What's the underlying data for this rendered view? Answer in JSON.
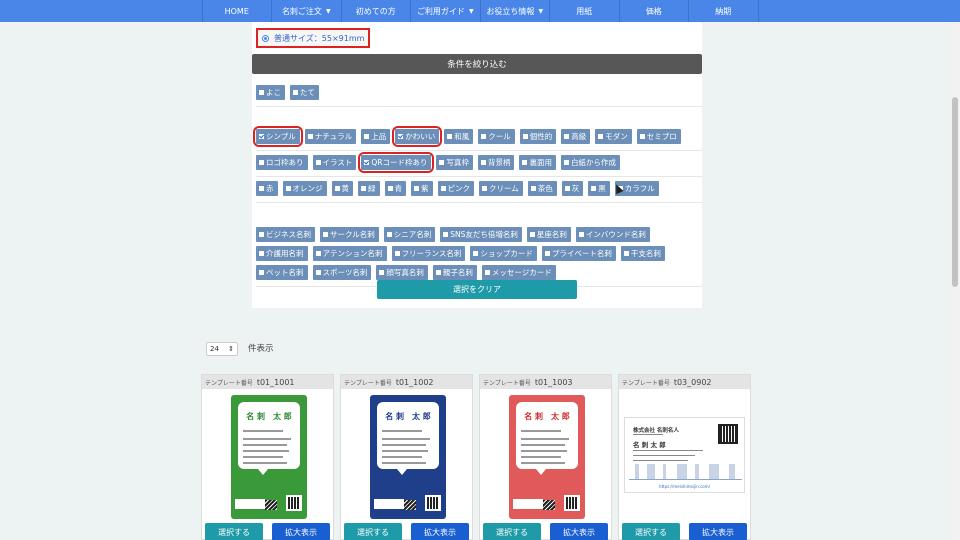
{
  "nav": [
    "HOME",
    "名刺ご注文",
    "初めての方",
    "ご利用ガイド",
    "お役立ち情報",
    "用紙",
    "価格",
    "納期"
  ],
  "nav_dropdown": [
    false,
    true,
    false,
    true,
    true,
    false,
    false,
    false
  ],
  "size_option": "普通サイズ：55×91mm",
  "refine_title": "条件を絞り込む",
  "filter_groups": [
    {
      "chips": [
        {
          "label": "よこ"
        },
        {
          "label": "たて"
        }
      ]
    },
    {
      "chips": [
        {
          "label": "シンプル",
          "checked": true,
          "hl": true
        },
        {
          "label": "ナチュラル"
        },
        {
          "label": "上品"
        },
        {
          "label": "かわいい",
          "checked": true,
          "hl": true
        },
        {
          "label": "和風"
        },
        {
          "label": "クール"
        },
        {
          "label": "個性的"
        },
        {
          "label": "高級"
        },
        {
          "label": "モダン"
        },
        {
          "label": "セミプロ"
        }
      ]
    },
    {
      "chips": [
        {
          "label": "ロゴ枠あり"
        },
        {
          "label": "イラスト"
        },
        {
          "label": "QRコード枠あり",
          "checked": true,
          "hl": true
        },
        {
          "label": "写真枠"
        },
        {
          "label": "背景柄"
        },
        {
          "label": "裏面用"
        },
        {
          "label": "白紙から作成"
        }
      ]
    },
    {
      "chips": [
        {
          "label": "赤"
        },
        {
          "label": "オレンジ"
        },
        {
          "label": "黄"
        },
        {
          "label": "緑"
        },
        {
          "label": "青"
        },
        {
          "label": "紫"
        },
        {
          "label": "ピンク"
        },
        {
          "label": "クリーム"
        },
        {
          "label": "茶色"
        },
        {
          "label": "灰"
        },
        {
          "label": "黒"
        },
        {
          "label": "カラフル"
        }
      ]
    },
    {
      "chips": [
        {
          "label": "ビジネス名刺"
        },
        {
          "label": "サークル名刺"
        },
        {
          "label": "シニア名刺"
        },
        {
          "label": "SNS友だち倍増名刺"
        },
        {
          "label": "星座名刺"
        },
        {
          "label": "インバウンド名刺"
        },
        {
          "label": "介護用名刺"
        },
        {
          "label": "アテンション名刺"
        },
        {
          "label": "フリーランス名刺"
        },
        {
          "label": "ショップカード"
        },
        {
          "label": "プライベート名刺"
        },
        {
          "label": "干支名刺"
        },
        {
          "label": "ペット名刺"
        },
        {
          "label": "スポーツ名刺"
        },
        {
          "label": "顔写真名刺"
        },
        {
          "label": "親子名刺"
        },
        {
          "label": "メッセージカード"
        }
      ]
    }
  ],
  "clear_button": "選択をクリア",
  "per_page": {
    "value": "24",
    "label": "件表示"
  },
  "template_label": "テンプレート番号",
  "select_label": "選択する",
  "zoom_label": "拡大表示",
  "templates": [
    {
      "id": "t01_1001",
      "color": "#3a9a3a",
      "orientation": "vertical",
      "title": "名 刺　太 郎",
      "title_color": "#2f8a2f"
    },
    {
      "id": "t01_1002",
      "color": "#1f3f8a",
      "orientation": "vertical",
      "title": "名 刺　太 郎",
      "title_color": "#1f3f8a"
    },
    {
      "id": "t01_1003",
      "color": "#e05a5a",
      "orientation": "vertical",
      "title": "名 刺　太 郎",
      "title_color": "#d03030"
    },
    {
      "id": "t03_0902",
      "color": "#ffffff",
      "orientation": "horizontal",
      "company": "株式会社 名刺名人",
      "name": "名 刺 太 郎",
      "url": "https://meishimeijin.com/"
    }
  ]
}
